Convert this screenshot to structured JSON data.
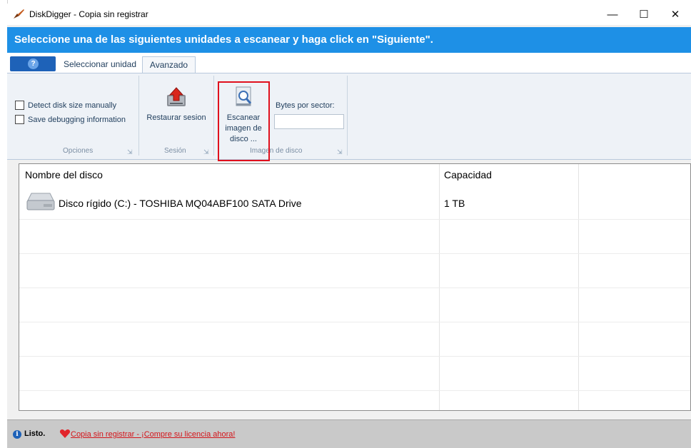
{
  "window": {
    "title": "DiskDigger - Copia sin registrar"
  },
  "window_controls": {
    "minimize": "—",
    "maximize": "☐",
    "close": "✕"
  },
  "header": {
    "instruction": "Seleccione una de las siguientes unidades a escanear y haga click en \"Siguiente\"."
  },
  "tabs": [
    {
      "label": "Seleccionar unidad",
      "active": false
    },
    {
      "label": "Avanzado",
      "active": true
    }
  ],
  "ribbon": {
    "opciones": {
      "detect_disk_size": "Detect disk size manually",
      "save_debugging": "Save debugging information",
      "group_label": "Opciones"
    },
    "sesion": {
      "restore_label": "Restaurar sesion",
      "group_label": "Sesión"
    },
    "imagen": {
      "scan_line1": "Escanear",
      "scan_line2": "imagen de",
      "scan_line3": "disco ...",
      "bytes_label": "Bytes por sector:",
      "bytes_value": "",
      "group_label": "Imagen de disco"
    },
    "launcher_glyph": "⇲"
  },
  "drive_list": {
    "columns": [
      "Nombre del disco",
      "Capacidad"
    ],
    "rows": [
      {
        "name": "Disco rígido (C:) - TOSHIBA MQ04ABF100 SATA Drive",
        "capacity": "1 TB"
      }
    ]
  },
  "status": {
    "state": "Listo.",
    "license_link": "Copia sin registrar - ¡Compre su licencia ahora!"
  },
  "colors": {
    "header_blue": "#1e90e6",
    "highlight_red": "#e0101d",
    "link_red": "#d4141a"
  }
}
